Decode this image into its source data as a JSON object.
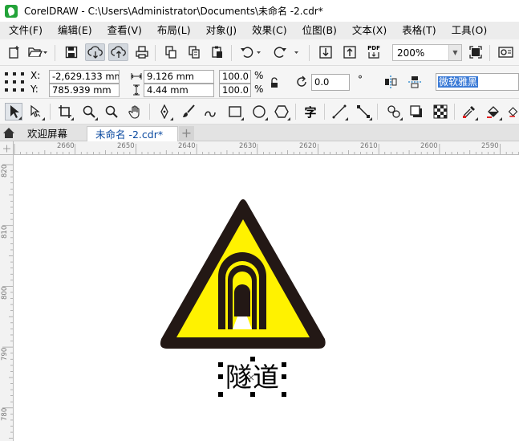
{
  "window": {
    "title": "CorelDRAW - C:\\Users\\Administrator\\Documents\\未命名 -2.cdr*"
  },
  "menu": {
    "items": [
      "文件(F)",
      "编辑(E)",
      "查看(V)",
      "布局(L)",
      "对象(J)",
      "效果(C)",
      "位图(B)",
      "文本(X)",
      "表格(T)",
      "工具(O)"
    ]
  },
  "standard_toolbar": {
    "zoom_level": "200%",
    "pdf_label": "PDF"
  },
  "property_bar": {
    "x_label": "X:",
    "y_label": "Y:",
    "x_value": "-2,629.133 mm",
    "y_value": "785.939 mm",
    "width_value": "9.126 mm",
    "height_value": "4.44 mm",
    "scale_w": "100.0",
    "scale_h": "100.0",
    "percent_symbol": "%",
    "rotation_value": "0.0",
    "degree_symbol": "°",
    "font_name": "微软雅黑"
  },
  "tabs": [
    {
      "label": "欢迎屏幕"
    },
    {
      "label": "未命名 -2.cdr*"
    }
  ],
  "ruler": {
    "horizontal_labels": [
      "2660",
      "2650",
      "2640",
      "2630",
      "2620",
      "2610",
      "2600",
      "2590"
    ],
    "vertical_labels": [
      "820",
      "810",
      "800",
      "790",
      "780"
    ]
  },
  "canvas": {
    "sign_text": "隧道",
    "colors": {
      "sign_fill": "#fff200",
      "sign_border": "#231815",
      "tunnel_symbol": "#231815"
    }
  }
}
